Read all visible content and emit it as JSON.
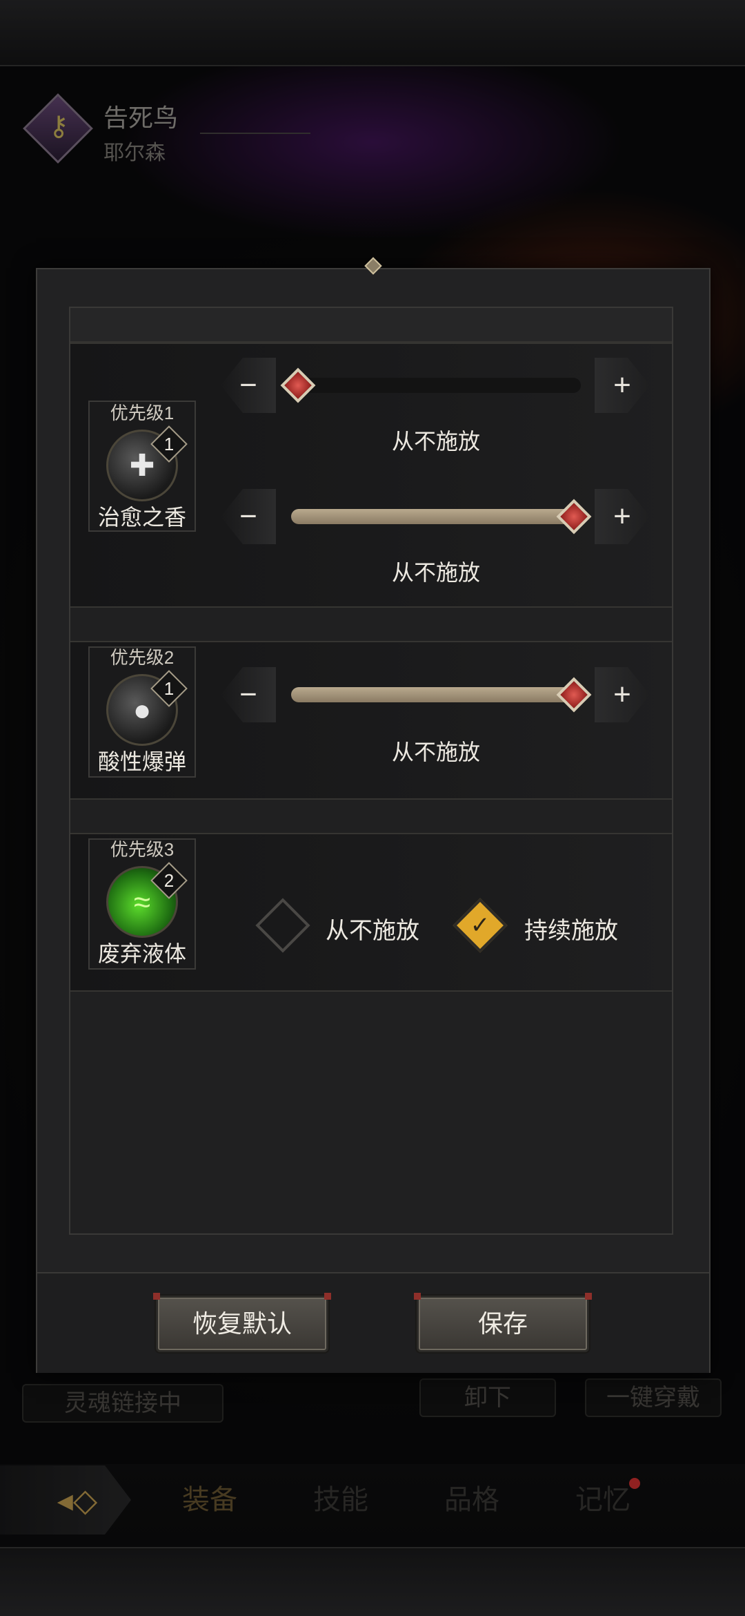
{
  "background": {
    "character": {
      "name": "告死鸟",
      "subtitle": "耶尔森"
    },
    "buttons": {
      "soul_link": "灵魂链接中",
      "unequip": "卸下",
      "equip_all": "一键穿戴"
    },
    "nav": {
      "back_icon": "back-arrow-icon",
      "tabs": [
        {
          "label": "装备",
          "active": true
        },
        {
          "label": "技能",
          "active": false
        },
        {
          "label": "品格",
          "active": false
        },
        {
          "label": "记忆",
          "active": false,
          "notification": true
        }
      ]
    }
  },
  "dialog": {
    "skills": [
      {
        "priority_label": "优先级1",
        "name": "治愈之香",
        "badge": "1",
        "sliders": [
          {
            "value_label": "从不施放",
            "level": 0.0
          },
          {
            "value_label": "从不施放",
            "level": 1.0
          }
        ]
      },
      {
        "priority_label": "优先级2",
        "name": "酸性爆弹",
        "badge": "1",
        "sliders": [
          {
            "value_label": "从不施放",
            "level": 1.0
          }
        ]
      },
      {
        "priority_label": "优先级3",
        "name": "废弃液体",
        "badge": "2",
        "options": [
          {
            "label": "从不施放",
            "checked": false
          },
          {
            "label": "持续施放",
            "checked": true
          }
        ]
      }
    ],
    "buttons": {
      "restore_default": "恢复默认",
      "save": "保存"
    }
  },
  "colors": {
    "accent_gold": "#e1a82a",
    "knob_red": "#c0392b",
    "bar_fill": "#a89a80",
    "notification_red": "#dd3333"
  }
}
